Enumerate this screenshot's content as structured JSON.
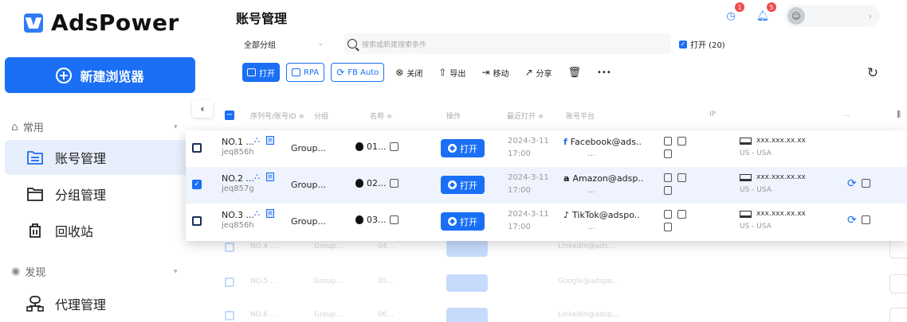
{
  "brand": {
    "name": "AdsPower",
    "color": "#1a6ff5"
  },
  "sidebar": {
    "new_browser": "新建浏览器",
    "sections": [
      {
        "label": "常用",
        "items": [
          {
            "label": "账号管理",
            "icon": "folder-list-icon",
            "active": true
          },
          {
            "label": "分组管理",
            "icon": "folder-icon",
            "active": false
          },
          {
            "label": "回收站",
            "icon": "trash-icon",
            "active": false
          }
        ]
      },
      {
        "label": "发现",
        "items": [
          {
            "label": "代理管理",
            "icon": "proxy-network-icon",
            "active": false
          }
        ]
      }
    ]
  },
  "header": {
    "title": "账号管理",
    "badges": {
      "sync": "1",
      "notifications": "5"
    }
  },
  "filters": {
    "group": "全部分组",
    "search_placeholder": "搜索或新建搜索条件",
    "open_filter": "打开 (20)"
  },
  "toolbar": {
    "open": "打开",
    "rpa": "RPA",
    "fb_auto": "FB Auto",
    "close": "关闭",
    "export": "导出",
    "move": "移动",
    "share": "分享",
    "more": "•••"
  },
  "table": {
    "headers": {
      "serial": "序列号/账号ID ≑",
      "group": "分组",
      "name": "名称 ≑",
      "action": "操作",
      "last_open": "最近打开 ≑",
      "platform": "账号平台",
      "ip": "IP",
      "more": "...",
      "columns_toggle": "⫼"
    },
    "rows": [
      {
        "no": "NO.1 ...",
        "id": "jeq856h",
        "group": "Group...",
        "name": "01...",
        "action": "打开",
        "date": "2024-3-11",
        "time": "17:00",
        "platform_icon": "f",
        "platform": "Facebook@ads..",
        "platform_sub": "...",
        "ip": "xxx.xxx.xx.xx",
        "location": "US - USA",
        "selected": false,
        "synced": false
      },
      {
        "no": "NO.2 ...",
        "id": "jeq857g",
        "group": "Group...",
        "name": "02...",
        "action": "打开",
        "date": "2024-3-11",
        "time": "17:00",
        "platform_icon": "a",
        "platform": "Amazon@adsp..",
        "platform_sub": "...",
        "ip": "xxx.xxx.xx.xx",
        "location": "US - USA",
        "selected": true,
        "synced": true
      },
      {
        "no": "NO.3 ...",
        "id": "jeq856h",
        "group": "Group...",
        "name": "03...",
        "action": "打开",
        "date": "2024-3-11",
        "time": "17:00",
        "platform_icon": "♪",
        "platform": "TikTok@adspo..",
        "platform_sub": "...",
        "ip": "xxx.xxx.xx.xx",
        "location": "US - USA",
        "selected": false,
        "synced": true
      }
    ],
    "ghost_rows": [
      {
        "no": "NO.4 ...",
        "group": "Group...",
        "name": "04...",
        "platform": "LinkedIn@ads..."
      },
      {
        "no": "NO.5 ...",
        "group": "Group...",
        "name": "05...",
        "platform": "Google@adspo..."
      },
      {
        "no": "NO.6 ...",
        "group": "Group...",
        "name": "06...",
        "platform": "LinkedIn@adsp..."
      }
    ]
  }
}
